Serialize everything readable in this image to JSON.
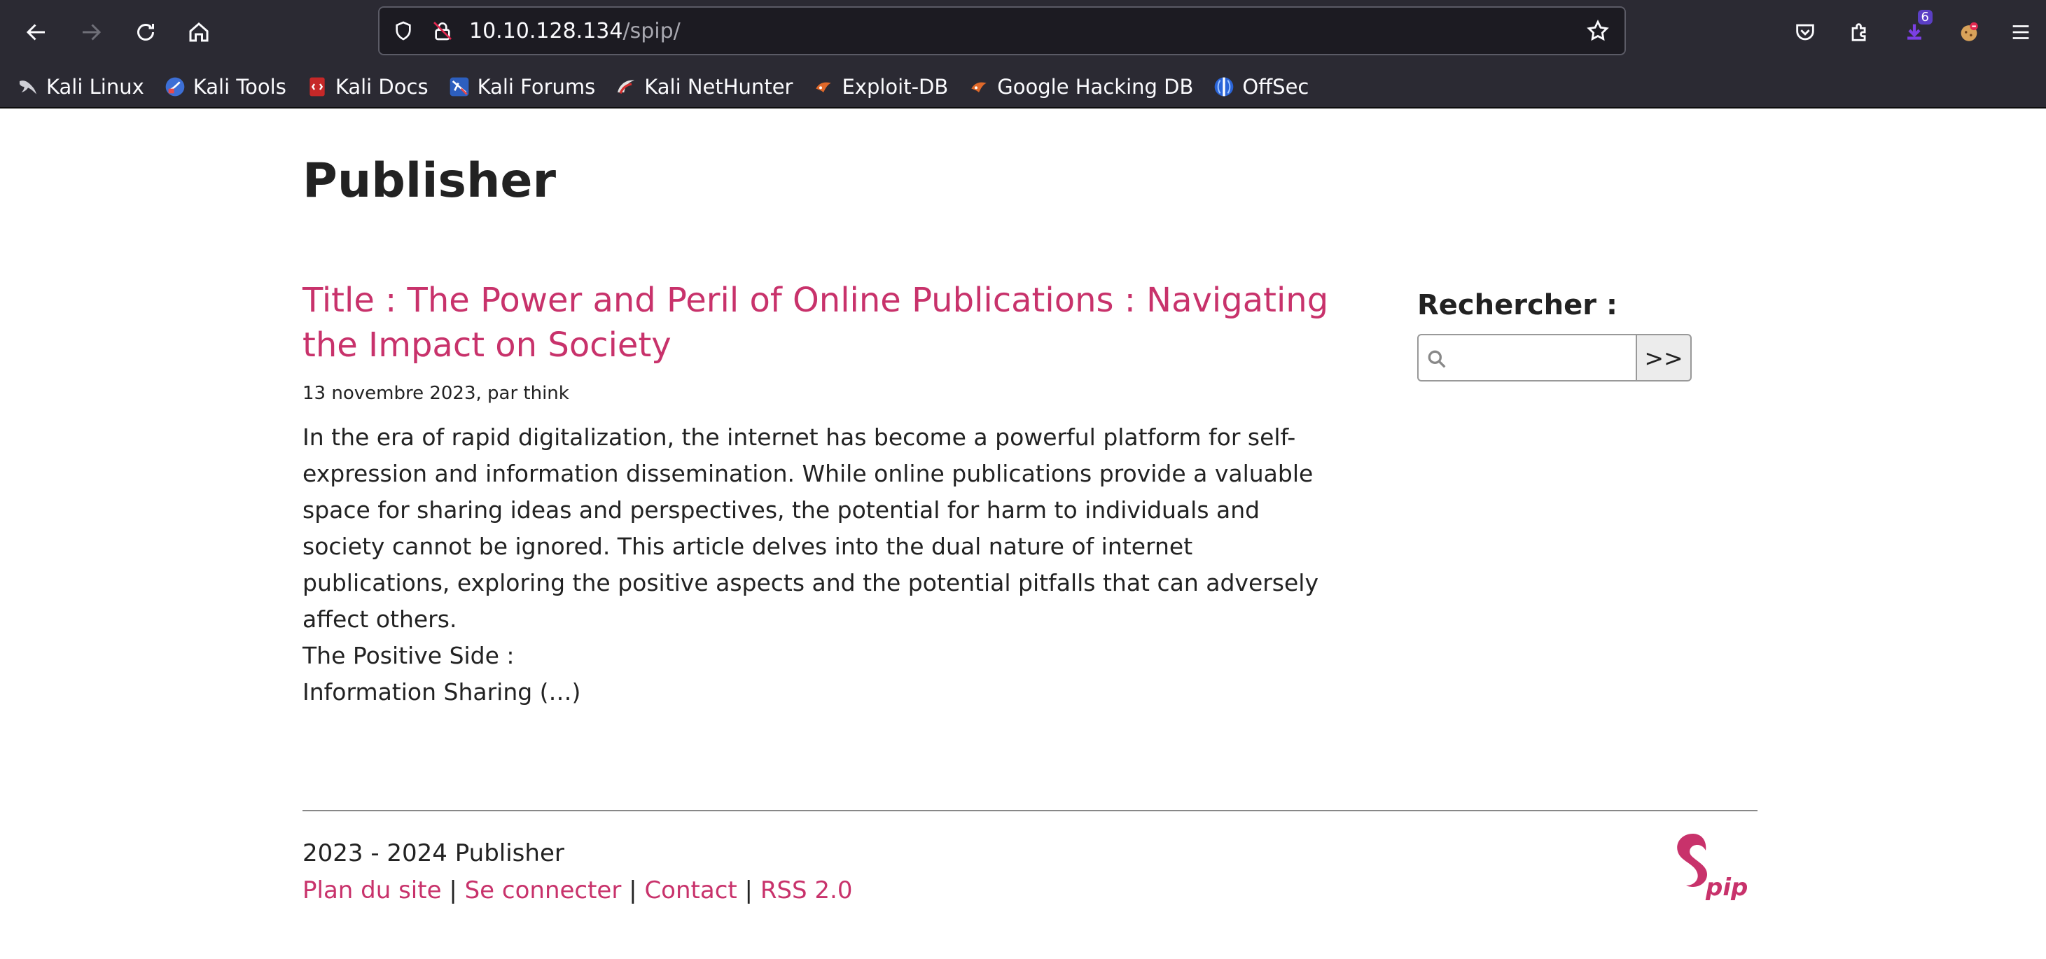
{
  "browser": {
    "url_host": "10.10.128.134",
    "url_path": "/spip/",
    "extension_badge": "6",
    "bookmarks": [
      {
        "label": "Kali Linux",
        "icon": "kali-dragon-icon",
        "color": "#cccccc"
      },
      {
        "label": "Kali Tools",
        "icon": "kali-tools-icon",
        "color": "#4a78d8"
      },
      {
        "label": "Kali Docs",
        "icon": "kali-docs-icon",
        "color": "#d43b3b"
      },
      {
        "label": "Kali Forums",
        "icon": "kali-forums-icon",
        "color": "#4a78d8"
      },
      {
        "label": "Kali NetHunter",
        "icon": "nethunter-icon",
        "color": "#d43b3b"
      },
      {
        "label": "Exploit-DB",
        "icon": "exploit-db-icon",
        "color": "#e0692a"
      },
      {
        "label": "Google Hacking DB",
        "icon": "ghdb-icon",
        "color": "#e0692a"
      },
      {
        "label": "OffSec",
        "icon": "offsec-icon",
        "color": "#3a7be0"
      }
    ]
  },
  "site": {
    "title": "Publisher",
    "accent_color": "#c8326b"
  },
  "article": {
    "title": "Title : The Power and Peril of Online Publications : Navigating the Impact on Society",
    "meta": "13 novembre 2023, par think",
    "intro": "In the era of rapid digitalization, the internet has become a powerful platform for self-expression and information dissemination. While online publications provide a valuable space for sharing ideas and perspectives, the potential for harm to individuals and society cannot be ignored. This article delves into the dual nature of internet publications, exploring the positive aspects and the potential pitfalls that can adversely affect others.",
    "subheading": "The Positive Side :",
    "excerpt_end": "Information Sharing (…)"
  },
  "search": {
    "label": "Rechercher :",
    "input_value": "",
    "button_label": ">>"
  },
  "footer": {
    "copyright": "2023 - 2024 Publisher",
    "links": [
      "Plan du site",
      "Se connecter",
      "Contact",
      "RSS 2.0"
    ],
    "separator": "|"
  }
}
